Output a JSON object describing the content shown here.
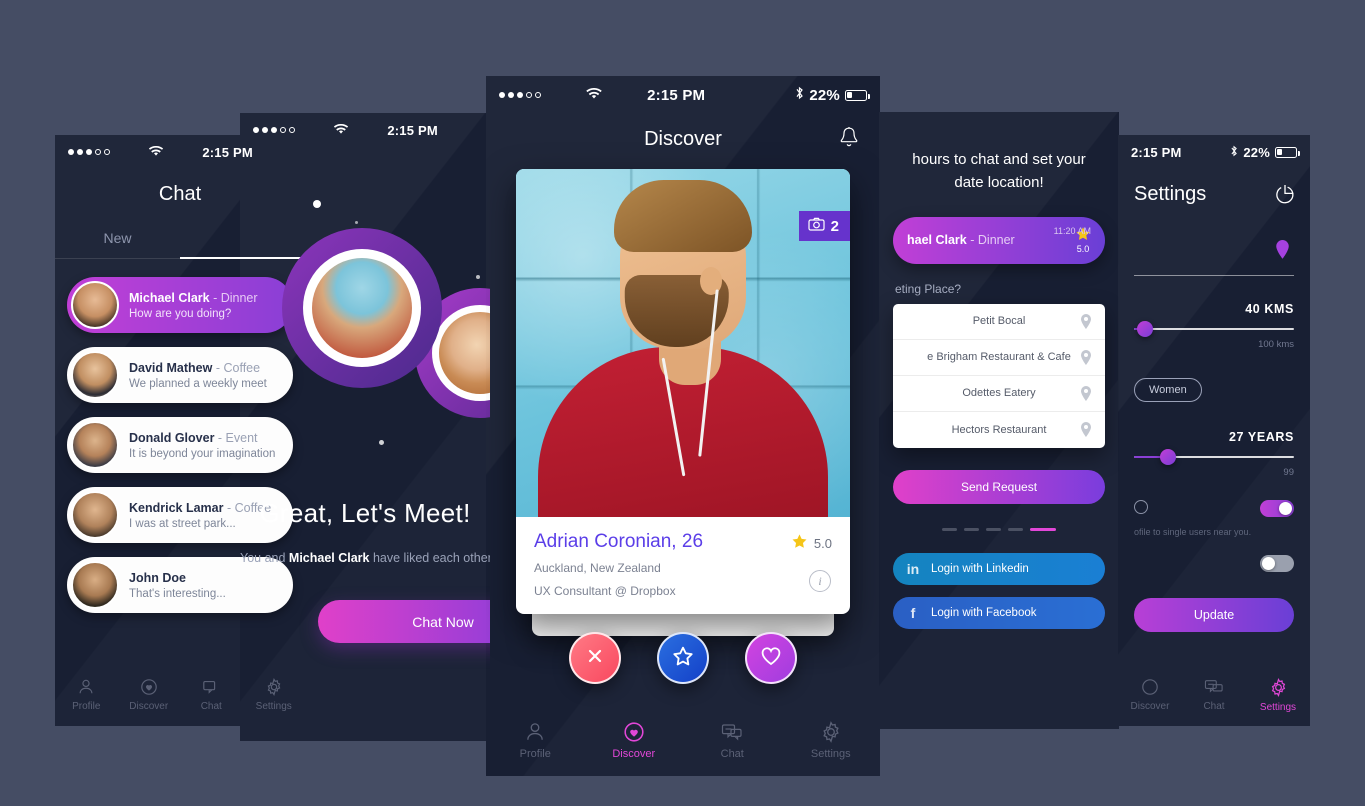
{
  "background_color": "#454d64",
  "accent_colors": {
    "purple": "#8a3fd6",
    "magenta": "#e247d8",
    "blue_link": "#5b3ee8",
    "badge_purple": "#6633cc",
    "star_yellow": "#f5c518"
  },
  "status_bar": {
    "time": "2:15 PM",
    "battery_percent": "22%",
    "wifi_icon": "wifi-icon",
    "bluetooth_icon": "bluetooth-icon",
    "signal_icon": "signal-dots-icon"
  },
  "chat_screen": {
    "title": "Chat",
    "tabs": [
      {
        "label": "New",
        "active": false
      },
      {
        "label": "",
        "active": true
      }
    ],
    "conversations": [
      {
        "name": "Michael Clark",
        "context": "- Dinner",
        "message": "How are you doing?",
        "active": true
      },
      {
        "name": "David Mathew",
        "context": "- Coffee",
        "message": "We planned a weekly meet",
        "active": false
      },
      {
        "name": "Donald Glover",
        "context": "- Event",
        "message": "It is beyond your imagination",
        "active": false
      },
      {
        "name": "Kendrick Lamar",
        "context": "- Coffee",
        "message": "I was at street park...",
        "active": false
      },
      {
        "name": "John Doe",
        "context": "",
        "message": "That's interesting...",
        "active": false
      }
    ],
    "tabbar": [
      {
        "label": "Profile",
        "icon": "profile-icon",
        "active": false
      },
      {
        "label": "Discover",
        "icon": "heart-icon",
        "active": false
      },
      {
        "label": "Chat",
        "icon": "chat-icon",
        "active": true
      },
      {
        "label": "Settings",
        "icon": "gear-icon",
        "active": false
      }
    ]
  },
  "match_screen": {
    "headline": "Great, Let's Meet!",
    "subtext_before": "You and ",
    "subtext_name": "Michael Clark",
    "subtext_after": " have liked each other",
    "button_label": "Chat Now"
  },
  "discover_screen": {
    "title": "Discover",
    "bell_icon": "bell-icon",
    "photo_count": "2",
    "camera_icon": "camera-icon",
    "profile": {
      "name": "Adrian Coronian,",
      "age": "26",
      "rating": "5.0",
      "star_icon": "star-icon",
      "location": "Auckland, New Zealand",
      "job": "UX Consultant @ Dropbox",
      "info_icon": "info-icon"
    },
    "actions": [
      {
        "name": "dislike",
        "icon": "close-icon"
      },
      {
        "name": "superlike",
        "icon": "star-icon"
      },
      {
        "name": "like",
        "icon": "heart-icon"
      }
    ],
    "tabbar": [
      {
        "label": "Profile",
        "icon": "profile-icon",
        "active": false
      },
      {
        "label": "Discover",
        "icon": "heart-icon",
        "active": true
      },
      {
        "label": "Chat",
        "icon": "chat-icon",
        "active": false
      },
      {
        "label": "Settings",
        "icon": "gear-icon",
        "active": false
      }
    ]
  },
  "date_screen": {
    "headline_line1": "hours to chat and set your",
    "headline_line2": "date location!",
    "match_card": {
      "name": "hael Clark",
      "context": "- Dinner",
      "rating": "5.0",
      "time": "11:20 AM",
      "star_icon": "star-icon"
    },
    "question": "eting Place?",
    "places": [
      {
        "label": "Petit Bocal",
        "pin_icon": "map-pin-icon"
      },
      {
        "label": "e Brigham Restaurant & Cafe",
        "pin_icon": "map-pin-icon"
      },
      {
        "label": "Odettes Eatery",
        "pin_icon": "map-pin-icon"
      },
      {
        "label": "Hectors Restaurant",
        "pin_icon": "map-pin-icon"
      }
    ],
    "send_label": "Send Request",
    "pager_total": 5,
    "pager_active": 5,
    "linkedin_label": "Login with Linkedin",
    "linkedin_icon": "linkedin-icon",
    "facebook_label": "Login with Facebook",
    "facebook_icon": "facebook-icon"
  },
  "settings_screen": {
    "title": "Settings",
    "logout_icon": "logout-icon",
    "location_pin_icon": "map-pin-icon",
    "distance": {
      "value": "40 KMS",
      "max": "100 kms",
      "percent": 8
    },
    "gender_chip": "Women",
    "age": {
      "value": "27 YEARS",
      "max": "99",
      "percent": 21
    },
    "visibility_note": "ofile to single users near you.",
    "toggle_1_state": "on",
    "toggle_2_state": "off",
    "update_label": "Update",
    "tabbar": [
      {
        "label": "Discover",
        "icon": "heart-icon",
        "active": false
      },
      {
        "label": "Chat",
        "icon": "chat-icon",
        "active": false
      },
      {
        "label": "Settings",
        "icon": "gear-icon",
        "active": true
      }
    ]
  }
}
